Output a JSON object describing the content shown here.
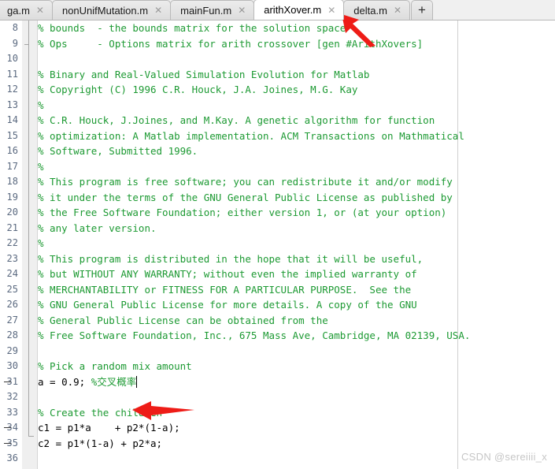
{
  "window": {
    "app": "matlab-editor",
    "accent_red": "#ee1c17",
    "comment_color": "#1d9a33",
    "code_color": "#000000",
    "linenum_color": "#5b6a80",
    "active_tab_bg": "#ffffff",
    "tab_bg": "#e3e3e3"
  },
  "tabbar": {
    "tabs": [
      {
        "label": "ga.m",
        "close": "✕",
        "active": false
      },
      {
        "label": "nonUnifMutation.m",
        "close": "✕",
        "active": false
      },
      {
        "label": "mainFun.m",
        "close": "✕",
        "active": false
      },
      {
        "label": "arithXover.m",
        "close": "✕",
        "active": true
      },
      {
        "label": "delta.m",
        "close": "✕",
        "active": false
      }
    ],
    "new_tab_label": "+"
  },
  "editor": {
    "first_visible_line": 8,
    "lines": [
      {
        "num": "8",
        "dash": false,
        "fold_tick": false,
        "parts": [
          {
            "t": "% bounds  - the bounds matrix for the solution space",
            "k": "cm"
          }
        ]
      },
      {
        "num": "9",
        "dash": false,
        "fold_tick": true,
        "parts": [
          {
            "t": "% Ops     - Options matrix for arith crossover [gen #ArithXovers]",
            "k": "cm"
          }
        ]
      },
      {
        "num": "10",
        "dash": false,
        "fold_tick": false,
        "parts": [
          {
            "t": "",
            "k": "cm"
          }
        ]
      },
      {
        "num": "11",
        "dash": false,
        "fold_tick": false,
        "parts": [
          {
            "t": "% Binary and Real-Valued Simulation Evolution for Matlab",
            "k": "cm"
          }
        ]
      },
      {
        "num": "12",
        "dash": false,
        "fold_tick": false,
        "parts": [
          {
            "t": "% Copyright (C) 1996 C.R. Houck, J.A. Joines, M.G. Kay",
            "k": "cm"
          }
        ]
      },
      {
        "num": "13",
        "dash": false,
        "fold_tick": false,
        "parts": [
          {
            "t": "%",
            "k": "cm"
          }
        ]
      },
      {
        "num": "14",
        "dash": false,
        "fold_tick": false,
        "parts": [
          {
            "t": "% C.R. Houck, J.Joines, and M.Kay. A genetic algorithm for function",
            "k": "cm"
          }
        ]
      },
      {
        "num": "15",
        "dash": false,
        "fold_tick": false,
        "parts": [
          {
            "t": "% optimization: A Matlab implementation. ACM Transactions on Mathmatical",
            "k": "cm"
          }
        ]
      },
      {
        "num": "16",
        "dash": false,
        "fold_tick": false,
        "parts": [
          {
            "t": "% Software, Submitted 1996.",
            "k": "cm"
          }
        ]
      },
      {
        "num": "17",
        "dash": false,
        "fold_tick": false,
        "parts": [
          {
            "t": "%",
            "k": "cm"
          }
        ]
      },
      {
        "num": "18",
        "dash": false,
        "fold_tick": false,
        "parts": [
          {
            "t": "% This program is free software; you can redistribute it and/or modify",
            "k": "cm"
          }
        ]
      },
      {
        "num": "19",
        "dash": false,
        "fold_tick": false,
        "parts": [
          {
            "t": "% it under the terms of the GNU General Public License as published by",
            "k": "cm"
          }
        ]
      },
      {
        "num": "20",
        "dash": false,
        "fold_tick": false,
        "parts": [
          {
            "t": "% the Free Software Foundation; either version 1, or (at your option)",
            "k": "cm"
          }
        ]
      },
      {
        "num": "21",
        "dash": false,
        "fold_tick": false,
        "parts": [
          {
            "t": "% any later version.",
            "k": "cm"
          }
        ]
      },
      {
        "num": "22",
        "dash": false,
        "fold_tick": false,
        "parts": [
          {
            "t": "%",
            "k": "cm"
          }
        ]
      },
      {
        "num": "23",
        "dash": false,
        "fold_tick": false,
        "parts": [
          {
            "t": "% This program is distributed in the hope that it will be useful,",
            "k": "cm"
          }
        ]
      },
      {
        "num": "24",
        "dash": false,
        "fold_tick": false,
        "parts": [
          {
            "t": "% but WITHOUT ANY WARRANTY; without even the implied warranty of",
            "k": "cm"
          }
        ]
      },
      {
        "num": "25",
        "dash": false,
        "fold_tick": false,
        "parts": [
          {
            "t": "% MERCHANTABILITY or FITNESS FOR A PARTICULAR PURPOSE.  See the",
            "k": "cm"
          }
        ]
      },
      {
        "num": "26",
        "dash": false,
        "fold_tick": false,
        "parts": [
          {
            "t": "% GNU General Public License for more details. A copy of the GNU",
            "k": "cm"
          }
        ]
      },
      {
        "num": "27",
        "dash": false,
        "fold_tick": false,
        "parts": [
          {
            "t": "% General Public License can be obtained from the",
            "k": "cm"
          }
        ]
      },
      {
        "num": "28",
        "dash": false,
        "fold_tick": false,
        "parts": [
          {
            "t": "% Free Software Foundation, Inc., 675 Mass Ave, Cambridge, MA 02139, USA.",
            "k": "cm"
          }
        ]
      },
      {
        "num": "29",
        "dash": false,
        "fold_tick": false,
        "parts": [
          {
            "t": "",
            "k": "cm"
          }
        ]
      },
      {
        "num": "30",
        "dash": false,
        "fold_tick": false,
        "parts": [
          {
            "t": "% Pick a random mix amount",
            "k": "cm"
          }
        ]
      },
      {
        "num": "31",
        "dash": true,
        "fold_tick": false,
        "caret": true,
        "parts": [
          {
            "t": "a = 0.9; ",
            "k": "pl"
          },
          {
            "t": "%交叉概率",
            "k": "cm"
          }
        ]
      },
      {
        "num": "32",
        "dash": false,
        "fold_tick": false,
        "parts": [
          {
            "t": "",
            "k": "cm"
          }
        ]
      },
      {
        "num": "33",
        "dash": false,
        "fold_tick": false,
        "parts": [
          {
            "t": "% Create the children",
            "k": "cm"
          }
        ]
      },
      {
        "num": "34",
        "dash": true,
        "fold_tick": false,
        "parts": [
          {
            "t": "c1 = p1*a    + p2*(1-a);",
            "k": "pl"
          }
        ]
      },
      {
        "num": "35",
        "dash": true,
        "fold_tick": false,
        "parts": [
          {
            "t": "c2 = p1*(1-a) + p2*a;",
            "k": "pl"
          }
        ]
      },
      {
        "num": "36",
        "dash": false,
        "fold_tick": false,
        "parts": [
          {
            "t": "",
            "k": "cm"
          }
        ]
      }
    ]
  },
  "annotations": {
    "arrow_tab_name": "red-arrow-pointing-to-active-tab",
    "arrow_line_name": "red-arrow-pointing-to-crossover-rate-comment"
  },
  "watermark": {
    "text": "CSDN @sereiiii_x"
  }
}
